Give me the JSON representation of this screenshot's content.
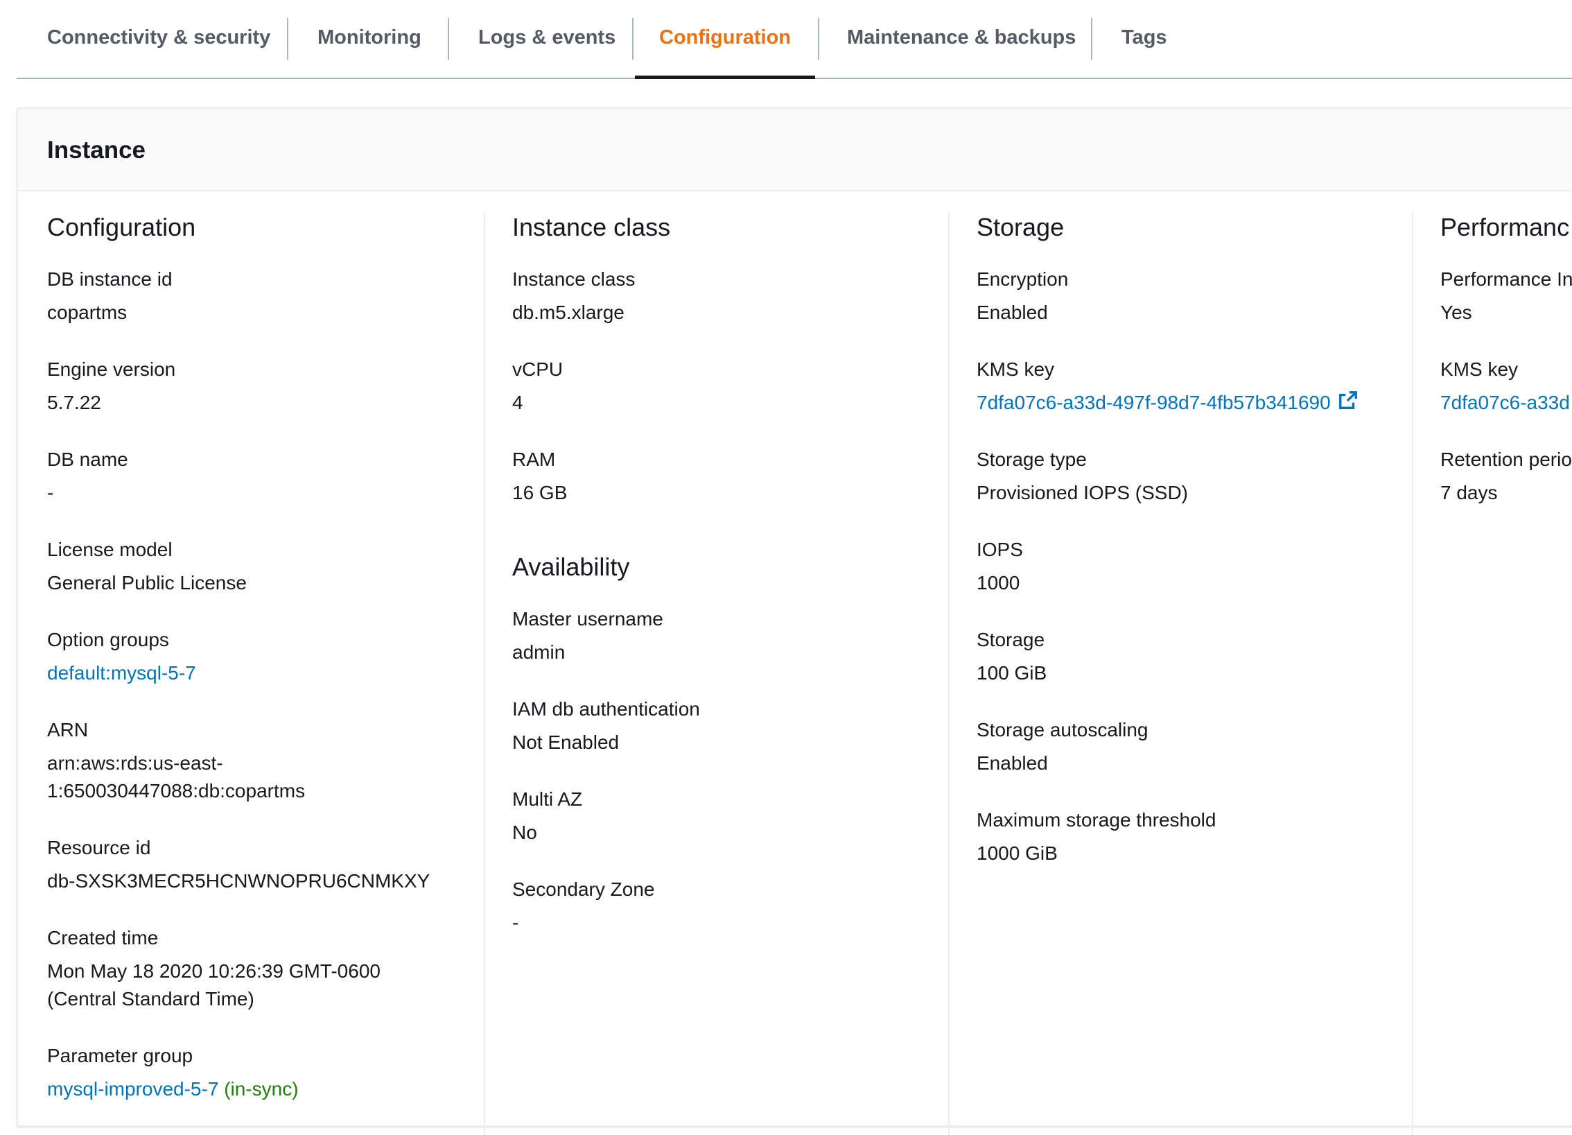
{
  "tabs": [
    {
      "label": "Connectivity & security"
    },
    {
      "label": "Monitoring"
    },
    {
      "label": "Logs & events"
    },
    {
      "label": "Configuration"
    },
    {
      "label": "Maintenance & backups"
    },
    {
      "label": "Tags"
    }
  ],
  "panel": {
    "title": "Instance"
  },
  "configuration": {
    "title": "Configuration",
    "db_instance_id": {
      "label": "DB instance id",
      "value": "copartms"
    },
    "engine_version": {
      "label": "Engine version",
      "value": "5.7.22"
    },
    "db_name": {
      "label": "DB name",
      "value": "-"
    },
    "license_model": {
      "label": "License model",
      "value": "General Public License"
    },
    "option_groups": {
      "label": "Option groups",
      "value": "default:mysql-5-7"
    },
    "arn": {
      "label": "ARN",
      "value_line1": "arn:aws:rds:us-east-",
      "value_line2": "1:650030447088:db:copartms"
    },
    "resource_id": {
      "label": "Resource id",
      "value": "db-SXSK3MECR5HCNWNOPRU6CNMKXY"
    },
    "created_time": {
      "label": "Created time",
      "value_line1": "Mon May 18 2020 10:26:39 GMT-0600",
      "value_line2": "(Central Standard Time)"
    },
    "parameter_group": {
      "label": "Parameter group",
      "value": "mysql-improved-5-7",
      "status": "(in-sync)"
    }
  },
  "instance_class": {
    "title": "Instance class",
    "instance_class": {
      "label": "Instance class",
      "value": "db.m5.xlarge"
    },
    "vcpu": {
      "label": "vCPU",
      "value": "4"
    },
    "ram": {
      "label": "RAM",
      "value": "16 GB"
    }
  },
  "availability": {
    "title": "Availability",
    "master_username": {
      "label": "Master username",
      "value": "admin"
    },
    "iam_auth": {
      "label": "IAM db authentication",
      "value": "Not Enabled"
    },
    "multi_az": {
      "label": "Multi AZ",
      "value": "No"
    },
    "secondary_zone": {
      "label": "Secondary Zone",
      "value": "-"
    }
  },
  "storage": {
    "title": "Storage",
    "encryption": {
      "label": "Encryption",
      "value": "Enabled"
    },
    "kms_key": {
      "label": "KMS key",
      "value": "7dfa07c6-a33d-497f-98d7-4fb57b341690"
    },
    "storage_type": {
      "label": "Storage type",
      "value": "Provisioned IOPS (SSD)"
    },
    "iops": {
      "label": "IOPS",
      "value": "1000"
    },
    "storage": {
      "label": "Storage",
      "value": "100 GiB"
    },
    "autoscaling": {
      "label": "Storage autoscaling",
      "value": "Enabled"
    },
    "max_threshold": {
      "label": "Maximum storage threshold",
      "value": "1000 GiB"
    }
  },
  "performance": {
    "title": "Performanc",
    "pi": {
      "label": "Performance In",
      "value": "Yes"
    },
    "kms_key": {
      "label": "KMS key",
      "value": "7dfa07c6-a33d"
    },
    "retention": {
      "label": "Retention perio",
      "value": "7 days"
    }
  },
  "colors": {
    "accent": "#ec7211",
    "link": "#0073bb",
    "success": "#1d8102"
  },
  "icons": {
    "external_link": "external-link-icon"
  }
}
